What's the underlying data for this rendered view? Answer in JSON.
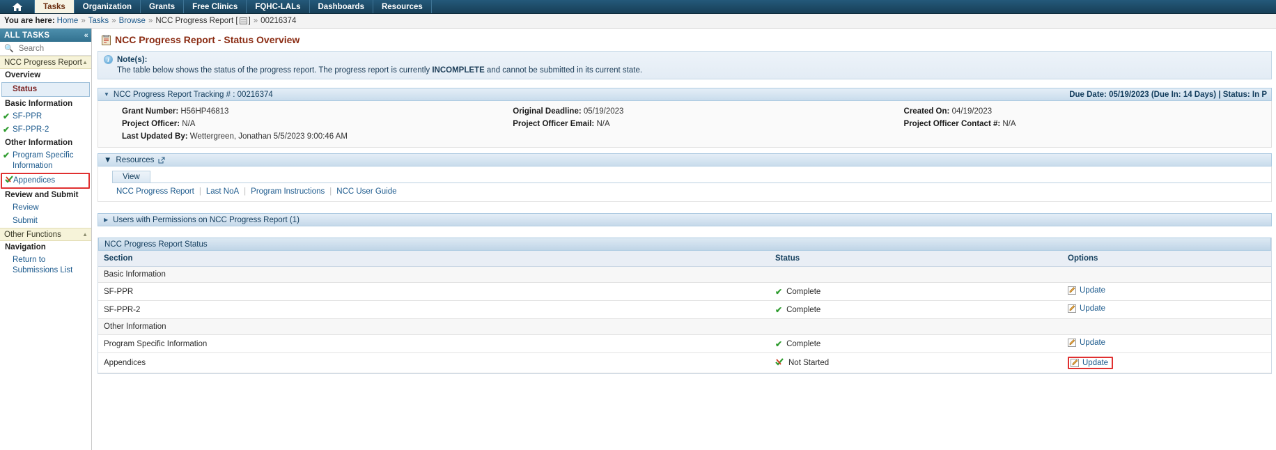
{
  "nav": {
    "home_icon": "home-icon",
    "tabs": [
      {
        "label": "Tasks",
        "active": true
      },
      {
        "label": "Organization",
        "active": false
      },
      {
        "label": "Grants",
        "active": false
      },
      {
        "label": "Free Clinics",
        "active": false
      },
      {
        "label": "FQHC-LALs",
        "active": false
      },
      {
        "label": "Dashboards",
        "active": false
      },
      {
        "label": "Resources",
        "active": false
      }
    ]
  },
  "breadcrumb": {
    "prefix": "You are here:",
    "items": [
      "Home",
      "Tasks",
      "Browse",
      "NCC Progress Report",
      "00216374"
    ],
    "separator": "»"
  },
  "sidebar": {
    "header": "ALL TASKS",
    "collapse_icon": "«",
    "search_placeholder": "Search",
    "search_value": "",
    "group": {
      "label": "NCC Progress Report",
      "caret": "▲"
    },
    "sections": [
      {
        "heading": "Overview",
        "items": [
          {
            "label": "Status",
            "current": true,
            "mark": "",
            "highlight": false
          }
        ]
      },
      {
        "heading": "Basic Information",
        "items": [
          {
            "label": "SF-PPR",
            "current": false,
            "mark": "check",
            "highlight": false
          },
          {
            "label": "SF-PPR-2",
            "current": false,
            "mark": "check",
            "highlight": false
          }
        ]
      },
      {
        "heading": "Other Information",
        "items": [
          {
            "label": "Program Specific Information",
            "current": false,
            "mark": "check",
            "highlight": false
          },
          {
            "label": "Appendices",
            "current": false,
            "mark": "partial",
            "highlight": true
          }
        ]
      },
      {
        "heading": "Review and Submit",
        "items": [
          {
            "label": "Review",
            "current": false,
            "mark": "",
            "highlight": false
          },
          {
            "label": "Submit",
            "current": false,
            "mark": "",
            "highlight": false
          }
        ]
      }
    ],
    "other_functions": {
      "label": "Other Functions",
      "caret": "▲"
    },
    "navigation_heading": "Navigation",
    "navigation_items": [
      {
        "label": "Return to Submissions List"
      }
    ]
  },
  "main": {
    "title": "NCC Progress Report - Status Overview",
    "title_icon": "clipboard-icon",
    "note": {
      "heading": "Note(s):",
      "icon": "info-icon",
      "text_before": "The table below shows the status of the progress report. The progress report is currently ",
      "emphasis": "INCOMPLETE",
      "text_after": " and cannot be submitted in its current state."
    },
    "tracking_panel": {
      "caret": "▼",
      "title": "NCC Progress Report Tracking # : 00216374",
      "right_text": "Due Date: 05/19/2023 (Due In: 14 Days) | Status: In P",
      "fields": [
        [
          {
            "label": "Grant Number:",
            "value": "H56HP46813"
          },
          {
            "label": "Original Deadline:",
            "value": "05/19/2023"
          },
          {
            "label": "Created On:",
            "value": "04/19/2023"
          }
        ],
        [
          {
            "label": "Project Officer:",
            "value": "N/A"
          },
          {
            "label": "Project Officer Email:",
            "value": "N/A"
          },
          {
            "label": "Project Officer Contact #:",
            "value": "N/A"
          }
        ],
        [
          {
            "label": "Last Updated By:",
            "value": "Wettergreen, Jonathan 5/5/2023 9:00:46 AM"
          },
          {
            "label": "",
            "value": ""
          },
          {
            "label": "",
            "value": ""
          }
        ]
      ]
    },
    "resources": {
      "caret": "▼",
      "title": "Resources",
      "external_icon": "external-link-icon",
      "tab_label": "View",
      "links": [
        "NCC Progress Report",
        "Last NoA",
        "Program Instructions",
        "NCC User Guide"
      ],
      "divider": "|"
    },
    "users_bar": {
      "caret": "▶",
      "label": "Users with Permissions on NCC Progress Report (1)"
    },
    "status_table": {
      "title": "NCC Progress Report Status",
      "columns": [
        "Section",
        "Status",
        "Options"
      ],
      "rows": [
        {
          "type": "group",
          "section": "Basic Information",
          "status": "",
          "status_mark": "",
          "option": "",
          "highlight": false
        },
        {
          "type": "row",
          "section": "SF-PPR",
          "status": "Complete",
          "status_mark": "check",
          "option": "Update",
          "highlight": false
        },
        {
          "type": "row",
          "section": "SF-PPR-2",
          "status": "Complete",
          "status_mark": "check",
          "option": "Update",
          "highlight": false
        },
        {
          "type": "group",
          "section": "Other Information",
          "status": "",
          "status_mark": "",
          "option": "",
          "highlight": false
        },
        {
          "type": "row",
          "section": "Program Specific Information",
          "status": "Complete",
          "status_mark": "check",
          "option": "Update",
          "highlight": false
        },
        {
          "type": "row",
          "section": "Appendices",
          "status": "Not Started",
          "status_mark": "partial",
          "option": "Update",
          "highlight": true
        }
      ]
    }
  },
  "colors": {
    "nav_bg": "#1b4965",
    "active_tab_bg": "#f6f3e4",
    "active_tab_text": "#6b2f10",
    "sidebar_header": "#3c7d9c",
    "group_bg": "#f6f3d9",
    "link": "#1c5a8d",
    "title": "#8a2b12",
    "highlight_red": "#e03030",
    "check_green": "#2f9c2f"
  }
}
